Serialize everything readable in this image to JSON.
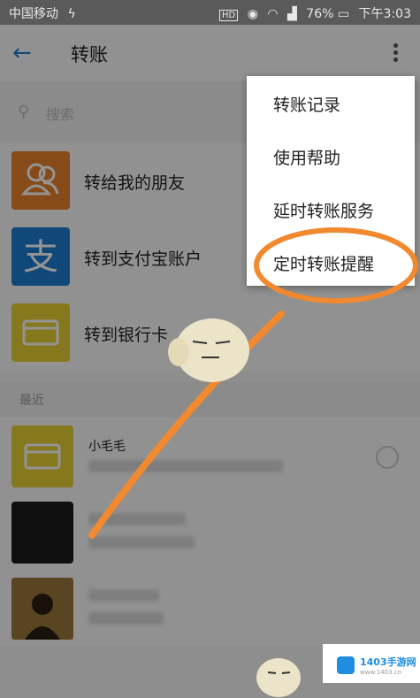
{
  "status_bar": {
    "carrier": "中国移动",
    "carrier_icon": "flash-icon",
    "icons": [
      "hd-icon",
      "eye-icon",
      "wifi-icon",
      "signal-icon"
    ],
    "battery": "76%",
    "time": "下午3:03"
  },
  "app_bar": {
    "back_icon": "arrow-left-icon",
    "title": "转账",
    "more_icon": "more-vertical-icon"
  },
  "search": {
    "placeholder": "搜索"
  },
  "transfer_options": [
    {
      "label": "转给我的朋友",
      "icon": "friends-icon",
      "color": "#e8802b"
    },
    {
      "label": "转到支付宝账户",
      "icon": "alipay-icon",
      "color": "#1c7fd0"
    },
    {
      "label": "转到银行卡",
      "icon": "bank-card-icon",
      "color": "#e7d032"
    }
  ],
  "recent_section": {
    "title": "最近"
  },
  "recent_contacts": [
    {
      "name": "小毛毛",
      "avatar_color": "#e7d032"
    },
    {
      "name": "",
      "avatar_color": "#1a1a1a"
    },
    {
      "name": "",
      "avatar_color": "#6a4f2a"
    }
  ],
  "menu": {
    "items": [
      "转账记录",
      "使用帮助",
      "延时转账服务",
      "定时转账提醒"
    ],
    "highlight_color": "#f0892f"
  },
  "watermark": {
    "title": "1403手游网",
    "subtitle": "www.1403.cn"
  }
}
